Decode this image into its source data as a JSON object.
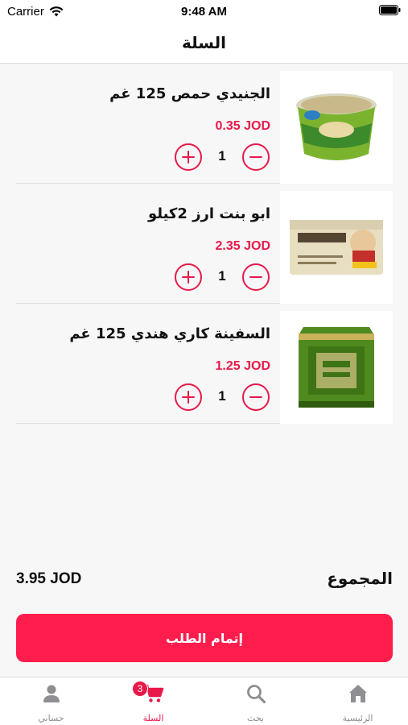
{
  "status_bar": {
    "carrier": "Carrier",
    "time": "9:48 AM"
  },
  "header": {
    "title": "السلة"
  },
  "cart": {
    "items": [
      {
        "name": "الجنيدي حمص 125 غم",
        "price": "0.35 JOD",
        "quantity": "1",
        "image": "hummus-can-image"
      },
      {
        "name": "ابو بنت ارز 2كيلو",
        "price": "2.35 JOD",
        "quantity": "1",
        "image": "rice-bag-image"
      },
      {
        "name": "السفينة كاري هندي 125 غم",
        "price": "1.25 JOD",
        "quantity": "1",
        "image": "curry-tin-image"
      }
    ]
  },
  "summary": {
    "label": "المجموع",
    "total": "3.95 JOD"
  },
  "checkout": {
    "label": "إتمام الطلب"
  },
  "tab_bar": {
    "tabs": [
      {
        "label": "حسابي",
        "icon": "person-icon"
      },
      {
        "label": "السلة",
        "icon": "cart-icon",
        "badge": "3",
        "active": true
      },
      {
        "label": "بحث",
        "icon": "search-icon"
      },
      {
        "label": "الرئيسية",
        "icon": "home-icon"
      }
    ]
  },
  "colors": {
    "accent": "#e8194a",
    "button": "#ff1d4e",
    "inactive": "#8e8e93"
  }
}
